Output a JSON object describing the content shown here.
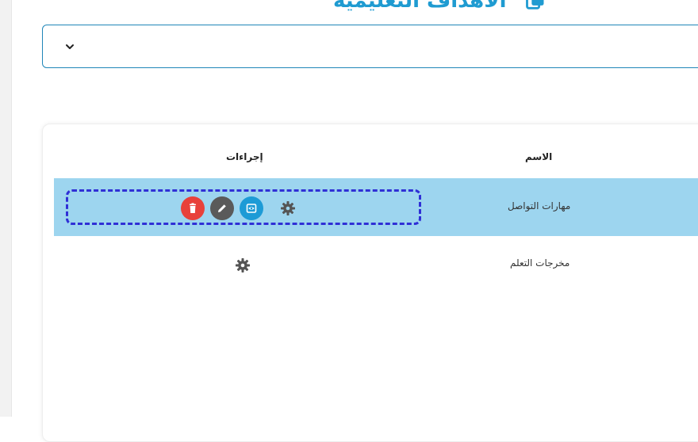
{
  "header": {
    "title": "الأهداف التعليمية",
    "icon": "copy-icon"
  },
  "filter": {
    "selected_value": "",
    "icon": "chevron-down-icon"
  },
  "table": {
    "columns": {
      "actions": "إجراءات",
      "name": "الاسم"
    },
    "rows": [
      {
        "name": "مهارات التواصل",
        "highlighted": true,
        "actions": [
          "delete-icon",
          "edit-icon",
          "view-icon",
          "gear-icon"
        ]
      },
      {
        "name": "مخرجات التعلم",
        "highlighted": false,
        "actions": [
          "gear-icon"
        ]
      }
    ]
  },
  "colors": {
    "accent": "#1f9bd1",
    "row_highlight": "#9dd5ef",
    "delete": "#e8413b",
    "edit": "#5a5a5a",
    "view": "#1d9bd6",
    "selection_outline": "#2f2fd6"
  }
}
